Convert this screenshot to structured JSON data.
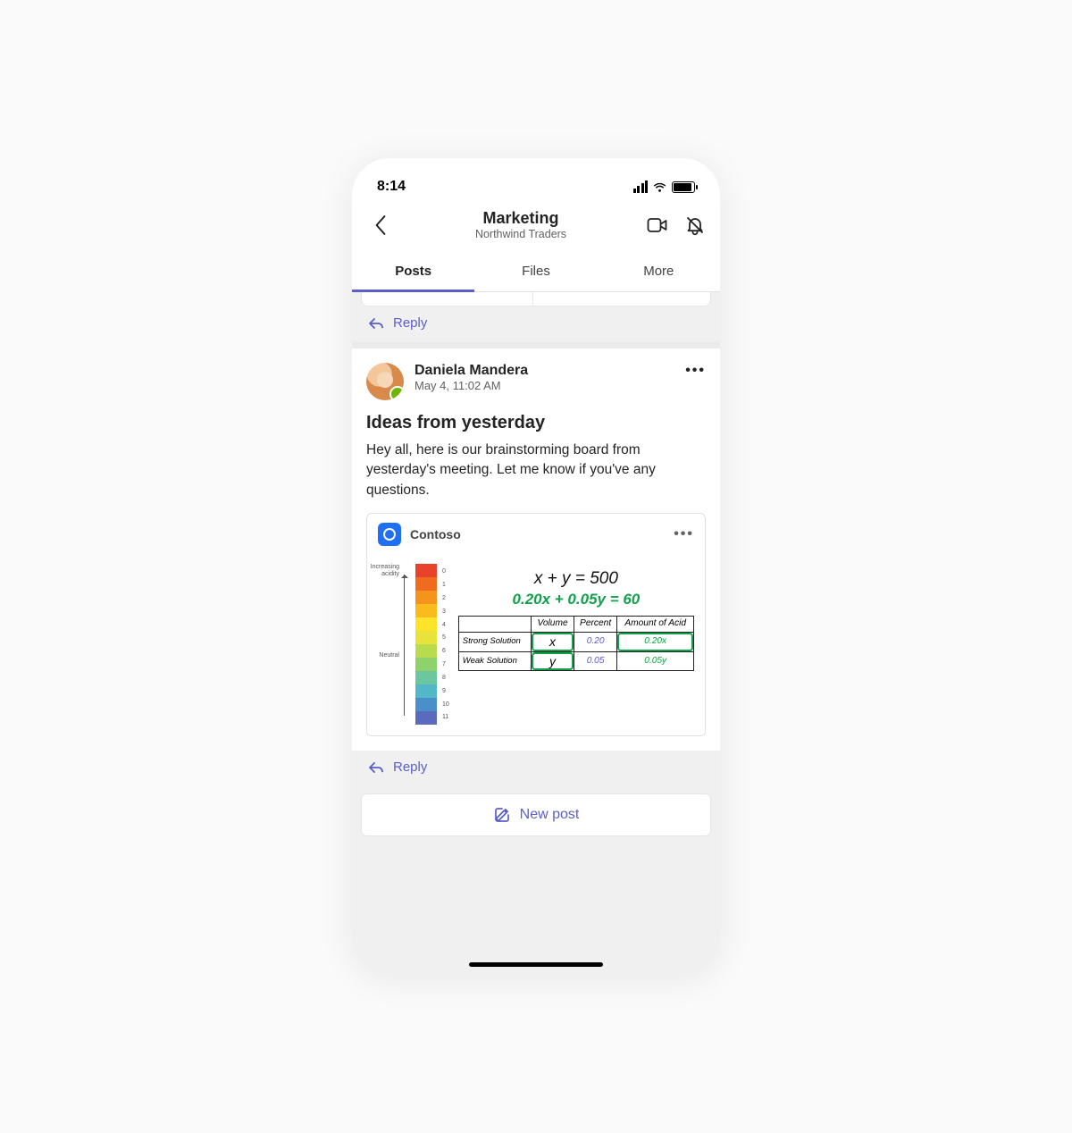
{
  "statusbar": {
    "time": "8:14"
  },
  "appbar": {
    "title": "Marketing",
    "subtitle": "Northwind Traders"
  },
  "tabs": [
    {
      "label": "Posts",
      "active": true
    },
    {
      "label": "Files",
      "active": false
    },
    {
      "label": "More",
      "active": false
    }
  ],
  "prev_thread": {
    "reply_label": "Reply"
  },
  "post": {
    "author": "Daniela Mandera",
    "timestamp": "May 4, 11:02 AM",
    "title": "Ideas from yesterday",
    "body": "Hey all, here is our brainstorming board from yesterday's meeting. Let me know if you've any questions.",
    "reply_label": "Reply"
  },
  "attachment": {
    "app_name": "Contoso",
    "scale": {
      "top_label": "Increasing\nacidity",
      "mid_label": "Neutral",
      "ticks": [
        "0",
        "1",
        "2",
        "3",
        "4",
        "5",
        "6",
        "7",
        "8",
        "9",
        "10",
        "11"
      ],
      "colors": [
        "#e8412c",
        "#ef6c1f",
        "#f4941c",
        "#f9bb1d",
        "#fde32a",
        "#e7e33a",
        "#b9dc4f",
        "#8fd26b",
        "#6cc6a0",
        "#52b7c6",
        "#4a8fc9",
        "#5a6bbd"
      ]
    },
    "equations": {
      "line1": "x + y = 500",
      "line2": "0.20x + 0.05y = 60"
    },
    "table": {
      "headers": [
        "",
        "Volume",
        "Percent",
        "Amount of Acid"
      ],
      "rows": [
        {
          "label": "Strong Solution",
          "volume": "x",
          "percent": "0.20",
          "amount": "0.20x"
        },
        {
          "label": "Weak Solution",
          "volume": "y",
          "percent": "0.05",
          "amount": "0.05y"
        }
      ]
    }
  },
  "composer": {
    "new_post_label": "New post"
  }
}
